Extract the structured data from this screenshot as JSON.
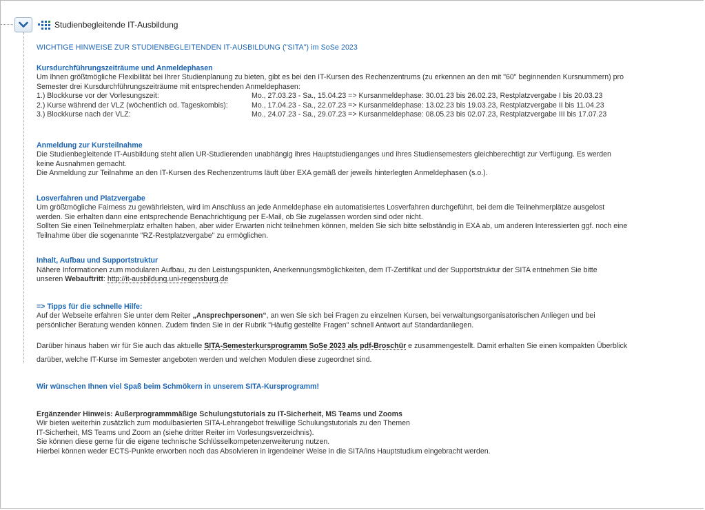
{
  "header": {
    "title": "Studienbegleitende IT-Ausbildung"
  },
  "main_heading": "WICHTIGE HINWEISE ZUR STUDIENBEGLEITENDEN IT-AUSBILDUNG (\"SITA\") im  SoSe 2023",
  "periods_section": {
    "heading": "Kursdurchführungszeiträume und Anmeldephasen",
    "intro_1": "Um Ihnen größtmögliche Flexibilität bei Ihrer Studienplanung zu bieten, gibt es bei den IT-Kursen des Rechenzentrums (zu erkennen an den mit \"60\" beginnenden Kursnummern) pro",
    "intro_2": "Semester drei Kursdurchführungszeiträume mit entsprechenden Anmeldephasen:",
    "rows": [
      {
        "label": "1.) Blockkurse vor der Vorlesungszeit:",
        "dates": "Mo., 27.03.23 - Sa., 15.04.23  => Kursanmeldephase: 30.01.23 bis 26.02.23, Restplatzvergabe I bis 20.03.23"
      },
      {
        "label": "2.) Kurse während der VLZ (wöchentlich od. Tageskombis):",
        "dates": "Mo., 17.04.23 - Sa., 22.07.23  => Kursanmeldephase: 13.02.23 bis 19.03.23, Restplatzvergabe II bis 11.04.23"
      },
      {
        "label": "3.) Blockkurse nach der VLZ:",
        "dates": "Mo., 24.07.23 - Sa., 29.07.23  => Kursanmeldephase: 08.05.23 bis 02.07.23, Restplatzvergabe III bis 17.07.23"
      }
    ]
  },
  "registration_section": {
    "heading": "Anmeldung zur Kursteilnahme",
    "line_1": "Die Studienbegleitende IT-Ausbildung steht allen UR-Studierenden unabhängig ihres Hauptstudienganges und ihres Studiensemesters gleichberechtigt zur Verfügung. Es werden",
    "line_2": "keine Ausnahmen gemacht.",
    "line_3": "Die Anmeldung zur Teilnahme an den IT-Kursen des Rechenzentrums läuft über EXA gemäß der jeweils hinterlegten Anmeldephasen (s.o.)."
  },
  "lottery_section": {
    "heading": "Losverfahren und Platzvergabe",
    "line_1": "Um größtmögliche Fairness zu gewährleisten, wird im Anschluss an jede Anmeldephase ein automatisiertes Losverfahren durchgeführt, bei dem die Teilnehmerplätze ausgelost",
    "line_2": "werden. Sie erhalten dann eine entsprechende Benachrichtigung per E-Mail, ob Sie zugelassen worden sind oder nicht.",
    "line_3": "Sollten Sie einen Teilnehmerplatz erhalten haben, aber wider Erwarten nicht teilnehmen können, melden Sie sich bitte selbständig in EXA ab, um anderen Interessierten ggf. noch eine",
    "line_4": "Teilnahme über die sogenannte \"RZ-Restplatzvergabe\" zu ermöglichen."
  },
  "structure_section": {
    "heading": "Inhalt, Aufbau und Supportstruktur",
    "line_1": "Nähere Informationen zum modularen Aufbau, zu den Leistungspunkten, Anerkennungsmöglichkeiten, dem IT-Zertifikat und der Supportstruktur der SITA entnehmen Sie bitte",
    "line_2_prefix": "unseren ",
    "web_label": "Webauftritt",
    "line_2_colon": ":  ",
    "web_link": "http://it-ausbildung.uni-regensburg.de"
  },
  "tips_section": {
    "heading": "=> Tipps für die schnelle Hilfe:",
    "line_1_prefix": "Auf der Webseite erfahren Sie unter dem Reiter ",
    "contact_tab": "„Ansprechpersonen“",
    "line_1_suffix": ", an wen Sie sich bei Fragen zu einzelnen Kursen, bei verwaltungsorganisatorischen Anliegen und bei",
    "line_2": "persönlicher Beratung wenden können. Zudem finden Sie in der Rubrik \"Häufig gestellte Fragen\" schnell Antwort auf Standardanliegen.",
    "line_3_prefix": "Darüber hinaus haben wir für Sie auch das aktuelle  ",
    "brochure_link": "SITA-Semesterkursprogramm SoSe 2023 als pdf-Broschür",
    "line_3_suffix": " e zusammengestellt. Damit erhalten Sie einen kompakten Überblick",
    "line_4": "darüber, welche IT-Kurse im Semester angeboten werden und welchen Modulen diese zugeordnet sind."
  },
  "closing": "Wir wünschen Ihnen viel Spaß beim Schmökern in unserem SITA-Kursprogramm!",
  "supplement_section": {
    "heading": "Ergänzender Hinweis: Außerprogrammmäßige Schulungstutorials zu IT-Sicherheit, MS Teams und Zooms",
    "line_1": "Wir bieten weiterhin zusätzlich zum modulbasierten SITA-Lehrangebot freiwillige Schulungstutorials zu den Themen",
    "line_2": "IT-Sicherheit, MS Teams und Zoom an (siehe dritter Reiter im Vorlesungsverzeichnis).",
    "line_3": "Sie können diese gerne für die eigene technische Schlüsselkompetenzerweiterung nutzen.",
    "line_4": "Hierbei können weder ECTS-Punkte erworben noch das Absolvieren in irgendeiner Weise in die SITA/ins Hauptstudium eingebracht werden."
  },
  "icons": {
    "toggle": "chevron-down-icon",
    "node": "grid-dots-icon"
  },
  "colors": {
    "heading_blue": "#1c64b4",
    "toggle_chevron": "#1f5fa8"
  }
}
